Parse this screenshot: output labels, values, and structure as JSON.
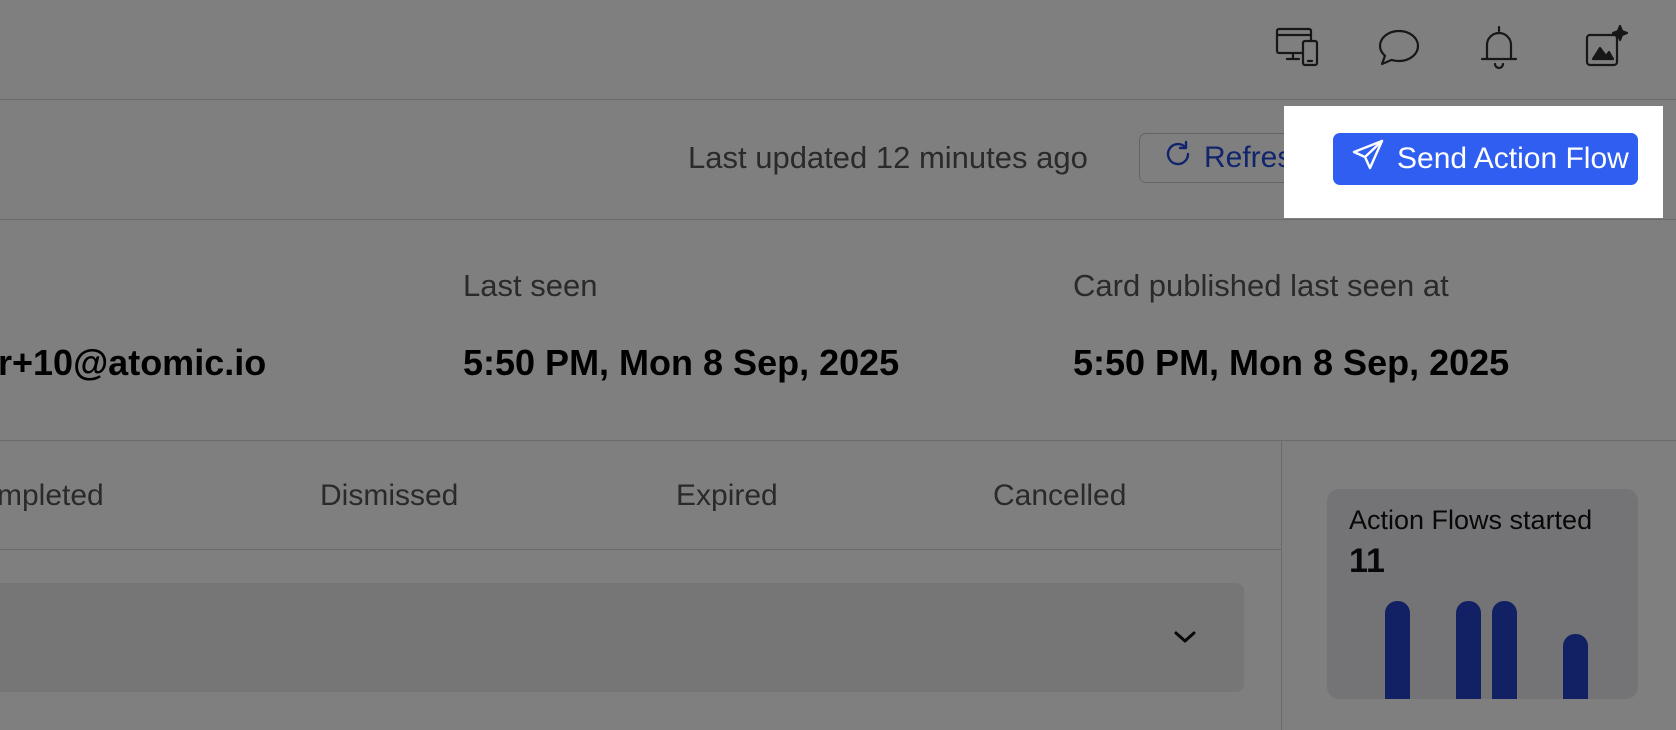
{
  "status": {
    "last_updated": "Last updated 12 minutes ago",
    "refresh_label": "Refresh",
    "send_label": "Send Action Flow"
  },
  "info": {
    "email_partial": "r+10@atomic.io",
    "last_seen_label": "Last seen",
    "last_seen_value": "5:50 PM, Mon 8 Sep, 2025",
    "card_published_label": "Card published last seen at",
    "card_published_value": "5:50 PM, Mon 8 Sep, 2025"
  },
  "tabs": [
    "mpleted",
    "Dismissed",
    "Expired",
    "Cancelled"
  ],
  "stat_card": {
    "label": "Action Flows started",
    "value": "11"
  },
  "chart_data": {
    "type": "bar",
    "values": [
      3,
      0,
      3,
      3,
      0,
      2
    ],
    "color": "#2443c9"
  },
  "icons": {
    "top": [
      "devices-icon",
      "chat-icon",
      "bell-icon",
      "sparkle-profile-icon"
    ]
  },
  "colors": {
    "primary": "#2f5ef0",
    "refresh_text": "#2449d8",
    "bar": "#2443c9"
  }
}
